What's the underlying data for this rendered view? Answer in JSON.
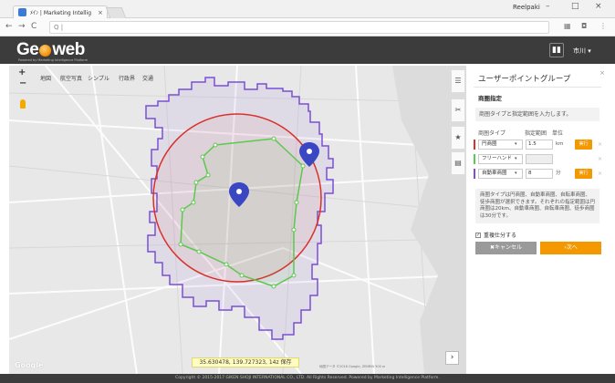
{
  "browser": {
    "tab_title": "ﾒｲﾝ | Marketing Intellig",
    "tab_close": "×",
    "profile": "Reelpaki",
    "win_min": "–",
    "win_max": "□",
    "win_close": "×",
    "back": "←",
    "forward": "→",
    "reload": "C",
    "address": "Q |"
  },
  "app": {
    "logo_pre": "Ge",
    "logo_post": "web",
    "logo_sub": "Powered by Marketing Intelligence Platform",
    "user": "市川 ▾"
  },
  "map": {
    "zoom_in": "+",
    "zoom_out": "−",
    "types": [
      "地図",
      "航空写真",
      "シンプル",
      "行政界",
      "交通"
    ],
    "coord": "35.630478, 139.727323, 14z  保存",
    "attribution": "地図データ ©2016 Google, ZENRIN  500 m",
    "google": "Google",
    "expand": "›",
    "colors": {
      "polygon": "#7a4fd6",
      "circle": "#d9302a",
      "freehand": "#5cc84d",
      "marker": "#3a46c2"
    }
  },
  "panel": {
    "title": "ユーザーポイントグループ",
    "close": "×",
    "section": "商圏指定",
    "instruction": "商圏タイプと指定範囲を入力します。",
    "col_type": "商圏タイプ",
    "col_range": "指定範囲",
    "col_unit": "単位",
    "rows": [
      {
        "type": "円商圏",
        "value": "1.5",
        "unit": "km",
        "button": "実行",
        "color": "#d9302a"
      },
      {
        "type": "フリーハンド",
        "value": "",
        "unit": "",
        "button": "",
        "color": "#5cc84d"
      },
      {
        "type": "自動車商圏",
        "value": "8",
        "unit": "分",
        "button": "実行",
        "color": "#7a4fd6"
      }
    ],
    "description": "商圏タイプは円商圏、自動車商圏、自転車商圏、徒歩商圏が選択できます。それぞれの指定範囲は円商圏は20km、自動車商圏、自転車商圏、徒歩商圏は30分です。",
    "check_label": "重複仕分する",
    "cancel": "✖キャンセル",
    "next": "›次へ"
  },
  "footer": "Copyright © 2015-2017 GIKEN SHOJI INTERNATIONAL CO., LTD. All Rights Reserved.  Powered by Marketing Intelligence Platform."
}
